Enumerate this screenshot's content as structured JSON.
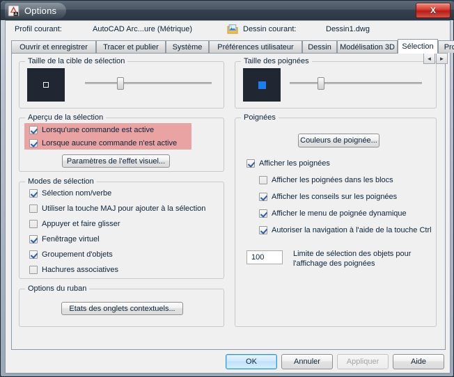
{
  "window": {
    "title": "Options",
    "app_icon": "autocad-a-icon",
    "close_label": "X",
    "accent": "#1a7ef0",
    "highlight_color": "#eaa3a3"
  },
  "profile_bar": {
    "profile_label": "Profil courant:",
    "profile_value": "AutoCAD Arc...ure (Métrique)",
    "drawing_icon": "drawing-file-icon",
    "drawing_label": "Dessin courant:",
    "drawing_value": "Dessin1.dwg"
  },
  "tabs": {
    "items": [
      {
        "label": "Ouvrir et enregistrer",
        "active": false
      },
      {
        "label": "Tracer et publier",
        "active": false
      },
      {
        "label": "Système",
        "active": false
      },
      {
        "label": "Préférences utilisateur",
        "active": false
      },
      {
        "label": "Dessin",
        "active": false
      },
      {
        "label": "Modélisation 3D",
        "active": false
      },
      {
        "label": "Sélection",
        "active": true
      },
      {
        "label": "Profils",
        "active": false
      }
    ],
    "scroll_left": "◄",
    "scroll_right": "►"
  },
  "pickbox_group": {
    "title": "Taille de la cible de sélection",
    "preview_icon": "pickbox-preview"
  },
  "grip_size_group": {
    "title": "Taille des poignées",
    "preview_icon": "grip-preview"
  },
  "selection_preview_group": {
    "title": "Aperçu de la sélection",
    "checkboxes": [
      {
        "label": "Lorsqu'une commande est active",
        "checked": true
      },
      {
        "label": "Lorsque aucune commande n'est active",
        "checked": true
      }
    ],
    "visual_effect_button": "Paramètres de l'effet visuel..."
  },
  "selection_modes_group": {
    "title": "Modes de sélection",
    "checkboxes": [
      {
        "label": "Sélection nom/verbe",
        "checked": true
      },
      {
        "label": "Utiliser la touche MAJ pour ajouter à la sélection",
        "checked": false
      },
      {
        "label": "Appuyer et faire glisser",
        "checked": false
      },
      {
        "label": "Fenêtrage virtuel",
        "checked": true
      },
      {
        "label": "Groupement d'objets",
        "checked": true
      },
      {
        "label": "Hachures associatives",
        "checked": false
      }
    ]
  },
  "grips_group": {
    "title": "Poignées",
    "grip_colors_button": "Couleurs de poignée...",
    "checkboxes": [
      {
        "label": "Afficher les poignées",
        "checked": true
      },
      {
        "label": "Afficher les poignées dans les blocs",
        "checked": false
      },
      {
        "label": "Afficher les conseils sur les poignées",
        "checked": true
      },
      {
        "label": "Afficher le menu de poignée dynamique",
        "checked": true
      },
      {
        "label": "Autoriser la navigation à l'aide de la touche Ctrl",
        "checked": true
      }
    ],
    "limit_value": "100",
    "limit_label_line1": "Limite de sélection des objets pour",
    "limit_label_line2": "l'affichage des poignées"
  },
  "ribbon_group": {
    "title": "Options du ruban",
    "contextual_tabs_button": "Etats des onglets contextuels..."
  },
  "footer": {
    "ok": "OK",
    "cancel": "Annuler",
    "apply": "Appliquer",
    "help": "Aide"
  }
}
